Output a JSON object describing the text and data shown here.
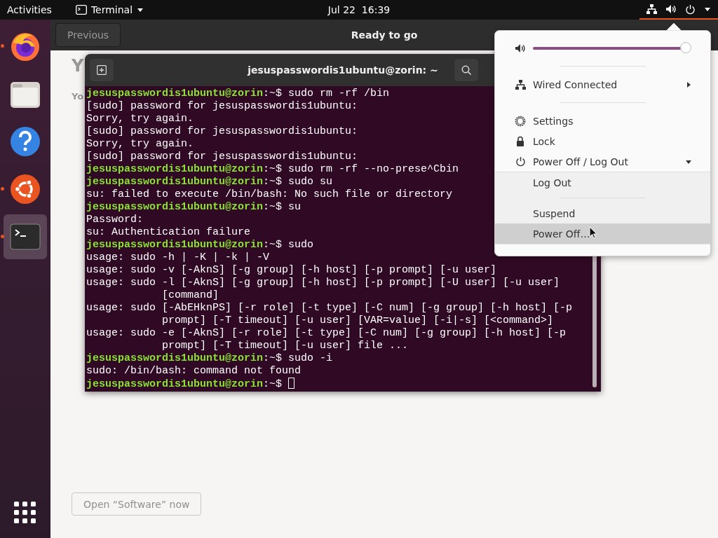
{
  "top_bar": {
    "activities": "Activities",
    "app_menu": "Terminal",
    "clock": "Jul 22  16:39",
    "status_active": true
  },
  "dock": {
    "items": [
      {
        "kind": "firefox",
        "running": true,
        "selected": false
      },
      {
        "kind": "files",
        "running": false,
        "selected": false
      },
      {
        "kind": "help",
        "running": false,
        "selected": false
      },
      {
        "kind": "software",
        "running": true,
        "selected": false
      },
      {
        "kind": "terminal",
        "running": true,
        "selected": true
      }
    ]
  },
  "installer": {
    "back_button": "Previous",
    "title": "Ready to go",
    "heading": "Y",
    "text": "Yo",
    "open_button": {
      "label": "Open “Software” now",
      "disabled": true
    }
  },
  "terminal": {
    "title": "jesuspasswordis1ubuntu@zorin: ~",
    "lines": [
      {
        "kind": "prompt",
        "user": "jesuspasswordis1ubuntu@zorin",
        "path": ":~$",
        "command": "sudo rm -rf /bin"
      },
      {
        "kind": "output",
        "text": "[sudo] password for jesuspasswordis1ubuntu:"
      },
      {
        "kind": "output",
        "text": "Sorry, try again."
      },
      {
        "kind": "output",
        "text": "[sudo] password for jesuspasswordis1ubuntu:"
      },
      {
        "kind": "output",
        "text": "Sorry, try again."
      },
      {
        "kind": "output",
        "text": "[sudo] password for jesuspasswordis1ubuntu:"
      },
      {
        "kind": "prompt",
        "user": "jesuspasswordis1ubuntu@zorin",
        "path": ":~$",
        "command": "sudo rm -rf --no-prese^Cbin"
      },
      {
        "kind": "prompt",
        "user": "jesuspasswordis1ubuntu@zorin",
        "path": ":~$",
        "command": "sudo su"
      },
      {
        "kind": "output",
        "text": "su: failed to execute /bin/bash: No such file or directory"
      },
      {
        "kind": "prompt",
        "user": "jesuspasswordis1ubuntu@zorin",
        "path": ":~$",
        "command": "su"
      },
      {
        "kind": "output",
        "text": "Password:"
      },
      {
        "kind": "output",
        "text": "su: Authentication failure"
      },
      {
        "kind": "prompt",
        "user": "jesuspasswordis1ubuntu@zorin",
        "path": ":~$",
        "command": "sudo"
      },
      {
        "kind": "output",
        "text": "usage: sudo -h | -K | -k | -V"
      },
      {
        "kind": "output",
        "text": "usage: sudo -v [-AknS] [-g group] [-h host] [-p prompt] [-u user]"
      },
      {
        "kind": "output",
        "text": "usage: sudo -l [-AknS] [-g group] [-h host] [-p prompt] [-U user] [-u user]"
      },
      {
        "kind": "wrap",
        "text": "[command]"
      },
      {
        "kind": "output",
        "text": "usage: sudo [-AbEHknPS] [-r role] [-t type] [-C num] [-g group] [-h host] [-p"
      },
      {
        "kind": "wrap",
        "text": "prompt] [-T timeout] [-u user] [VAR=value] [-i|-s] [<command>]"
      },
      {
        "kind": "output",
        "text": "usage: sudo -e [-AknS] [-r role] [-t type] [-C num] [-g group] [-h host] [-p"
      },
      {
        "kind": "wrap",
        "text": "prompt] [-T timeout] [-u user] file ..."
      },
      {
        "kind": "prompt",
        "user": "jesuspasswordis1ubuntu@zorin",
        "path": ":~$",
        "command": "sudo -i"
      },
      {
        "kind": "output",
        "text": "sudo: /bin/bash: command not found"
      },
      {
        "kind": "prompt",
        "user": "jesuspasswordis1ubuntu@zorin",
        "path": ":~$",
        "cursor": true
      }
    ]
  },
  "system_menu": {
    "volume": {
      "level": 1.0
    },
    "network": {
      "label": "Wired Connected"
    },
    "actions": [
      {
        "label": "Settings"
      },
      {
        "label": "Lock"
      }
    ],
    "power": {
      "label": "Power Off / Log Out",
      "expanded": true,
      "submenu": [
        {
          "label": "Log Out",
          "selected": false
        },
        {
          "label": "Suspend",
          "selected": false
        },
        {
          "label": "Power Off…",
          "selected": true
        }
      ]
    }
  }
}
